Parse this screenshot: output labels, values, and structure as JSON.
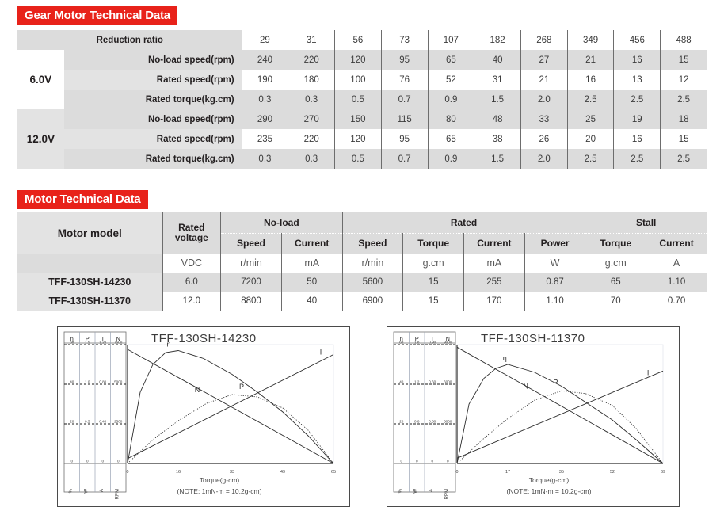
{
  "gear_section": {
    "banner": "Gear Motor Technical Data",
    "row_header": "Reduction ratio",
    "ratios": [
      "29",
      "31",
      "56",
      "73",
      "107",
      "182",
      "268",
      "349",
      "456",
      "488"
    ],
    "voltage_groups": [
      {
        "voltage": "6.0V",
        "rows": [
          {
            "label": "No-load speed(rpm)",
            "values": [
              "240",
              "220",
              "120",
              "95",
              "65",
              "40",
              "27",
              "21",
              "16",
              "15"
            ]
          },
          {
            "label": "Rated speed(rpm)",
            "values": [
              "190",
              "180",
              "100",
              "76",
              "52",
              "31",
              "21",
              "16",
              "13",
              "12"
            ]
          },
          {
            "label": "Rated torque(kg.cm)",
            "values": [
              "0.3",
              "0.3",
              "0.5",
              "0.7",
              "0.9",
              "1.5",
              "2.0",
              "2.5",
              "2.5",
              "2.5"
            ]
          }
        ]
      },
      {
        "voltage": "12.0V",
        "rows": [
          {
            "label": "No-load speed(rpm)",
            "values": [
              "290",
              "270",
              "150",
              "115",
              "80",
              "48",
              "33",
              "25",
              "19",
              "18"
            ]
          },
          {
            "label": "Rated speed(rpm)",
            "values": [
              "235",
              "220",
              "120",
              "95",
              "65",
              "38",
              "26",
              "20",
              "16",
              "15"
            ]
          },
          {
            "label": "Rated torque(kg.cm)",
            "values": [
              "0.3",
              "0.3",
              "0.5",
              "0.7",
              "0.9",
              "1.5",
              "2.0",
              "2.5",
              "2.5",
              "2.5"
            ]
          }
        ]
      }
    ]
  },
  "motor_section": {
    "banner": "Motor Technical Data",
    "col_model": "Motor model",
    "col_rated_voltage": "Rated\nvoltage",
    "col_rated_voltage_l1": "Rated",
    "col_rated_voltage_l2": "voltage",
    "groups": [
      {
        "name": "No-load",
        "cols": [
          "Speed",
          "Current"
        ]
      },
      {
        "name": "Rated",
        "cols": [
          "Speed",
          "Torque",
          "Current",
          "Power"
        ]
      },
      {
        "name": "Stall",
        "cols": [
          "Torque",
          "Current"
        ]
      }
    ],
    "units": [
      "VDC",
      "r/min",
      "mA",
      "r/min",
      "g.cm",
      "mA",
      "W",
      "g.cm",
      "A"
    ],
    "rows": [
      {
        "model": "TFF-130SH-14230",
        "values": [
          "6.0",
          "7200",
          "50",
          "5600",
          "15",
          "255",
          "0.87",
          "65",
          "1.10"
        ]
      },
      {
        "model": "TFF-130SH-11370",
        "values": [
          "12.0",
          "8800",
          "40",
          "6900",
          "15",
          "170",
          "1.10",
          "70",
          "0.70"
        ]
      }
    ]
  },
  "chart_data": [
    {
      "type": "line",
      "title": "TFF-130SH-14230",
      "xlabel": "Torque(g-cm)",
      "note": "(NOTE: 1mN-m = 10.2g-cm)",
      "x_ticks": [
        "0",
        "16",
        "33",
        "49",
        "65"
      ],
      "xlim": [
        0,
        65
      ],
      "grid": false,
      "legend": [
        "η",
        "P",
        "I",
        "N"
      ],
      "axes": [
        {
          "symbol": "η",
          "unit": "%",
          "ticks": [
            "0",
            "20",
            "40",
            "60"
          ],
          "max": 60
        },
        {
          "symbol": "P",
          "unit": "W",
          "ticks": [
            "0",
            "0.5",
            "1.0",
            "1.5"
          ],
          "max": 1.5
        },
        {
          "symbol": "I",
          "unit": "A",
          "ticks": [
            "0",
            "0.40",
            "0.80",
            "1.20"
          ],
          "max": 1.2
        },
        {
          "symbol": "N",
          "unit": "RPM",
          "ticks": [
            "0",
            "2500",
            "5000",
            "7500"
          ],
          "max": 7500
        }
      ],
      "series": [
        {
          "name": "N",
          "desc": "speed falls linearly from no-load 7200 rpm to 0 at stall 65 g.cm",
          "x": [
            0,
            65
          ],
          "y": [
            7200,
            0
          ]
        },
        {
          "name": "I",
          "desc": "current rises linearly from 50 mA to stall 1.10 A",
          "x": [
            0,
            65
          ],
          "y": [
            0.05,
            1.1
          ]
        },
        {
          "name": "P",
          "desc": "output power parabola peaking 0.87 W near 33 g.cm",
          "x": [
            0,
            8,
            16,
            25,
            33,
            41,
            49,
            57,
            65
          ],
          "y": [
            0,
            0.3,
            0.54,
            0.76,
            0.87,
            0.84,
            0.7,
            0.42,
            0
          ]
        },
        {
          "name": "η",
          "desc": "efficiency peaks ~57% near 15 g.cm then decays to 0 at stall",
          "x": [
            0,
            4,
            8,
            12,
            16,
            24,
            33,
            41,
            49,
            57,
            65
          ],
          "y": [
            0,
            36,
            50,
            56,
            57,
            53,
            45,
            36,
            26,
            14,
            0
          ]
        }
      ]
    },
    {
      "type": "line",
      "title": "TFF-130SH-11370",
      "xlabel": "Torque(g-cm)",
      "note": "(NOTE: 1mN-m = 10.2g-cm)",
      "x_ticks": [
        "0",
        "17",
        "35",
        "52",
        "69"
      ],
      "xlim": [
        0,
        69
      ],
      "grid": false,
      "legend": [
        "η",
        "P",
        "I",
        "N"
      ],
      "axes": [
        {
          "symbol": "η",
          "unit": "%",
          "ticks": [
            "0",
            "20",
            "40",
            "60"
          ],
          "max": 60
        },
        {
          "symbol": "P",
          "unit": "W",
          "ticks": [
            "0",
            "0.6",
            "1.2",
            "1.8"
          ],
          "max": 1.8
        },
        {
          "symbol": "I",
          "unit": "A",
          "ticks": [
            "0",
            "0.30",
            "0.60",
            "0.90"
          ],
          "max": 0.9
        },
        {
          "symbol": "N",
          "unit": "RPM",
          "ticks": [
            "0",
            "3000",
            "6000",
            "9000"
          ],
          "max": 9000
        }
      ],
      "series": [
        {
          "name": "N",
          "desc": "speed falls linearly from no-load 8800 rpm to 0 at stall 70 g.cm",
          "x": [
            0,
            69
          ],
          "y": [
            8800,
            0
          ]
        },
        {
          "name": "I",
          "desc": "current rises linearly from 40 mA to stall 0.70 A",
          "x": [
            0,
            69
          ],
          "y": [
            0.04,
            0.7
          ]
        },
        {
          "name": "P",
          "desc": "output power parabola peaking 1.10 W near 35 g.cm",
          "x": [
            0,
            9,
            17,
            26,
            35,
            43,
            52,
            60,
            69
          ],
          "y": [
            0,
            0.38,
            0.68,
            0.96,
            1.1,
            1.06,
            0.88,
            0.53,
            0
          ]
        },
        {
          "name": "η",
          "desc": "efficiency peaks ~50% near 17 g.cm then decays to 0 at stall",
          "x": [
            0,
            4,
            9,
            13,
            17,
            26,
            35,
            43,
            52,
            60,
            69
          ],
          "y": [
            0,
            30,
            43,
            48,
            50,
            46,
            39,
            31,
            22,
            12,
            0
          ]
        }
      ]
    }
  ]
}
